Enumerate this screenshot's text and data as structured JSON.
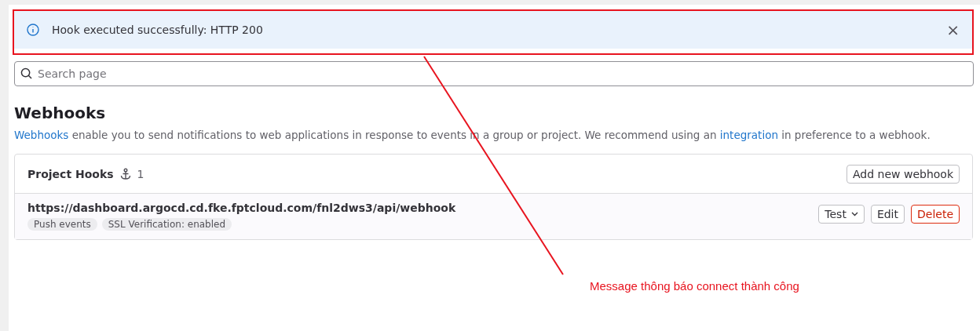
{
  "alert": {
    "message": "Hook executed successfully: HTTP 200",
    "close": "×"
  },
  "search": {
    "placeholder": "Search page"
  },
  "heading": "Webhooks",
  "description": [
    {
      "kind": "link",
      "text": "Webhooks"
    },
    {
      "kind": "text",
      "text": " enable you to send notifications to web applications in response to events in a group or project. We recommend using an "
    },
    {
      "kind": "link",
      "text": "integration"
    },
    {
      "kind": "text",
      "text": " in preference to a webhook."
    }
  ],
  "card": {
    "title": "Project Hooks",
    "count": "1",
    "add_button": "Add new webhook",
    "hooks": [
      {
        "url": "https://dashboard.argocd.cd.fke.fptcloud.com/fnl2dws3/api/webhook",
        "tags": [
          "Push events",
          "SSL Verification: enabled"
        ],
        "actions": [
          {
            "kind": "dropdown",
            "label": "Test"
          },
          {
            "kind": "default",
            "label": "Edit"
          },
          {
            "kind": "danger",
            "label": "Delete"
          }
        ]
      }
    ]
  },
  "annotation": {
    "text": "Message thông báo connect thành công"
  }
}
